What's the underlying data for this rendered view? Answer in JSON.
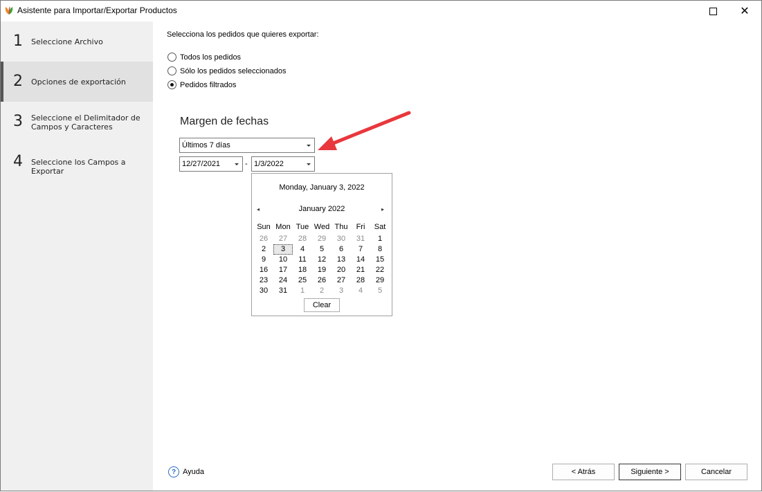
{
  "window": {
    "title": "Asistente para Importar/Exportar Productos"
  },
  "steps": [
    {
      "num": "1",
      "label": "Seleccione Archivo"
    },
    {
      "num": "2",
      "label": "Opciones de exportación"
    },
    {
      "num": "3",
      "label": "Seleccione el Delimitador de Campos y Caracteres"
    },
    {
      "num": "4",
      "label": "Seleccione los Campos a Exportar"
    }
  ],
  "main": {
    "prompt": "Selecciona los pedidos que quieres exportar:",
    "options": [
      {
        "label": "Todos los pedidos",
        "checked": false
      },
      {
        "label": "Sólo los pedidos seleccionados",
        "checked": false
      },
      {
        "label": "Pedidos filtrados",
        "checked": true
      }
    ],
    "date_range_title": "Margen de fechas",
    "range_select": "Últimos 7 días",
    "date_from": "12/27/2021",
    "date_separator": "-",
    "date_to": "1/3/2022"
  },
  "calendar": {
    "header": "Monday, January 3, 2022",
    "month": "January 2022",
    "prev": "◂",
    "next": "▸",
    "weekdays": [
      "Sun",
      "Mon",
      "Tue",
      "Wed",
      "Thu",
      "Fri",
      "Sat"
    ],
    "weeks": [
      [
        "26",
        "27",
        "28",
        "29",
        "30",
        "31",
        "1"
      ],
      [
        "2",
        "3",
        "4",
        "5",
        "6",
        "7",
        "8"
      ],
      [
        "9",
        "10",
        "11",
        "12",
        "13",
        "14",
        "15"
      ],
      [
        "16",
        "17",
        "18",
        "19",
        "20",
        "21",
        "22"
      ],
      [
        "23",
        "24",
        "25",
        "26",
        "27",
        "28",
        "29"
      ],
      [
        "30",
        "31",
        "1",
        "2",
        "3",
        "4",
        "5"
      ]
    ],
    "clear_label": "Clear"
  },
  "footer": {
    "help_label": "Ayuda",
    "back_label": "< Atrás",
    "next_label": "Siguiente >",
    "cancel_label": "Cancelar"
  },
  "colors": {
    "annotation_arrow": "#e8383d",
    "help_icon": "#2a6cc4"
  }
}
